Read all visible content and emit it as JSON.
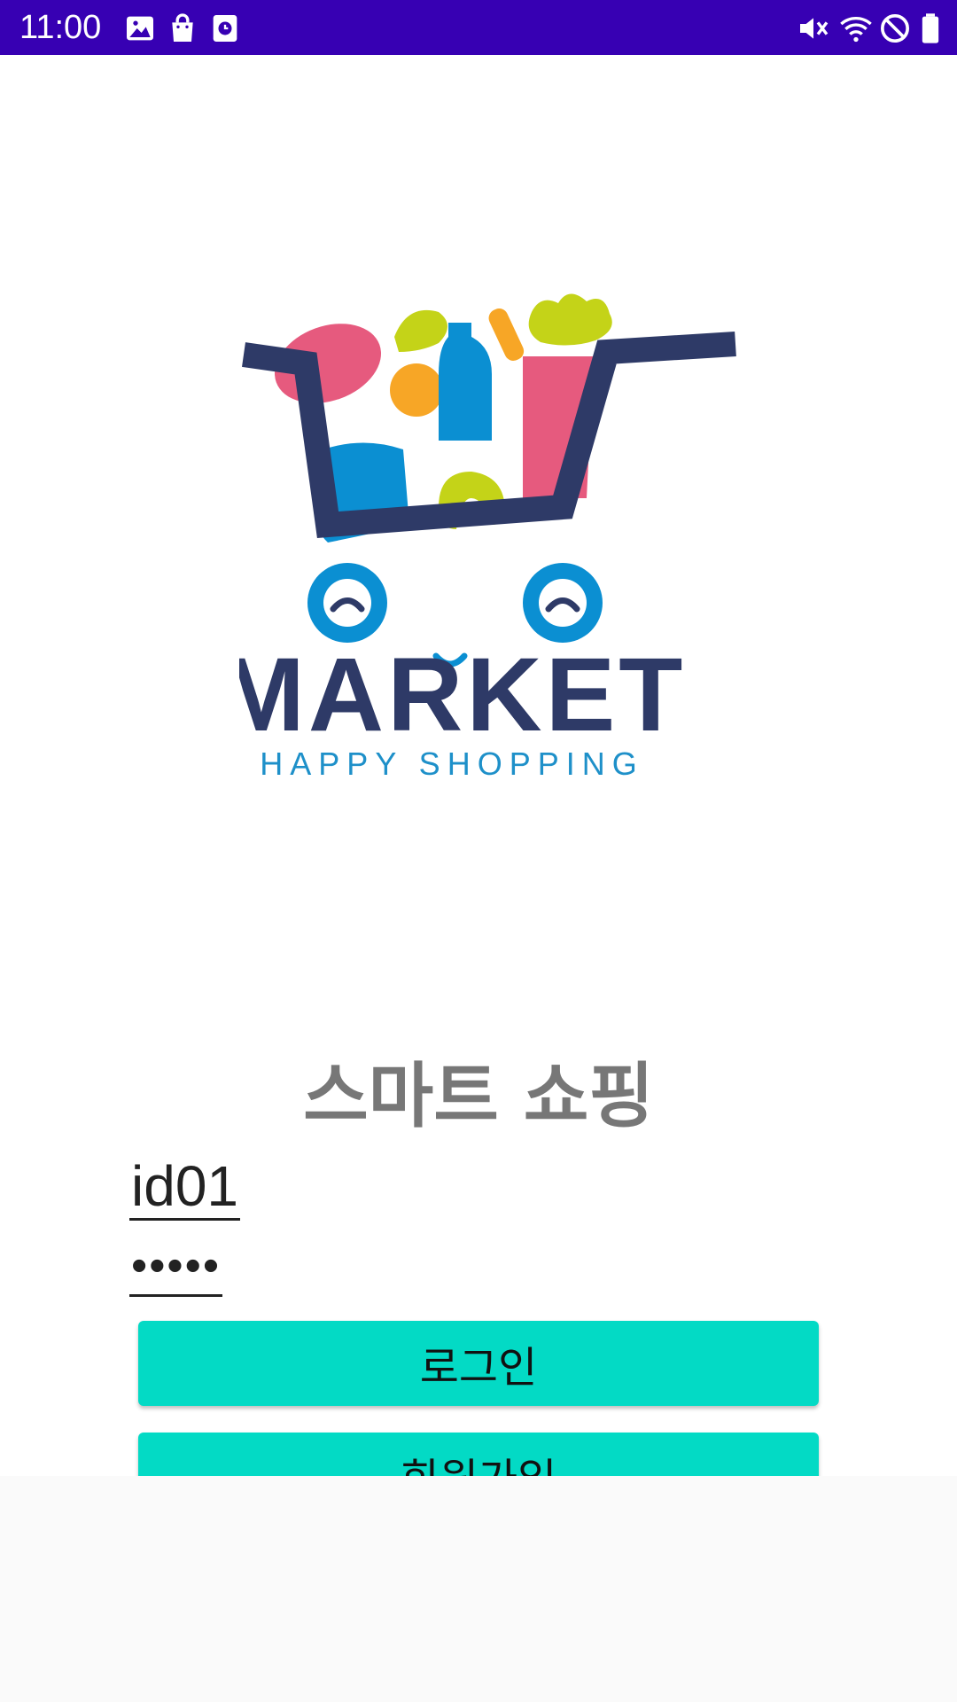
{
  "status_bar": {
    "time": "11:00",
    "background_color": "#3700b3",
    "left_icons": [
      "image-icon",
      "shopping-bag-icon",
      "clock-app-icon"
    ],
    "right_icons": [
      "vibrate-mute-icon",
      "wifi-icon",
      "do-not-disturb-icon",
      "battery-icon"
    ]
  },
  "logo": {
    "brand_name": "MARKET",
    "tagline": "HAPPY SHOPPING",
    "brand_color": "#2e3a67",
    "tagline_color": "#1e90c9"
  },
  "login": {
    "title": "스마트 쇼핑",
    "id_value": "id01",
    "password_masked": "•••••",
    "login_button_label": "로그인",
    "signup_button_label": "회원가입",
    "button_color": "#03dac5"
  }
}
